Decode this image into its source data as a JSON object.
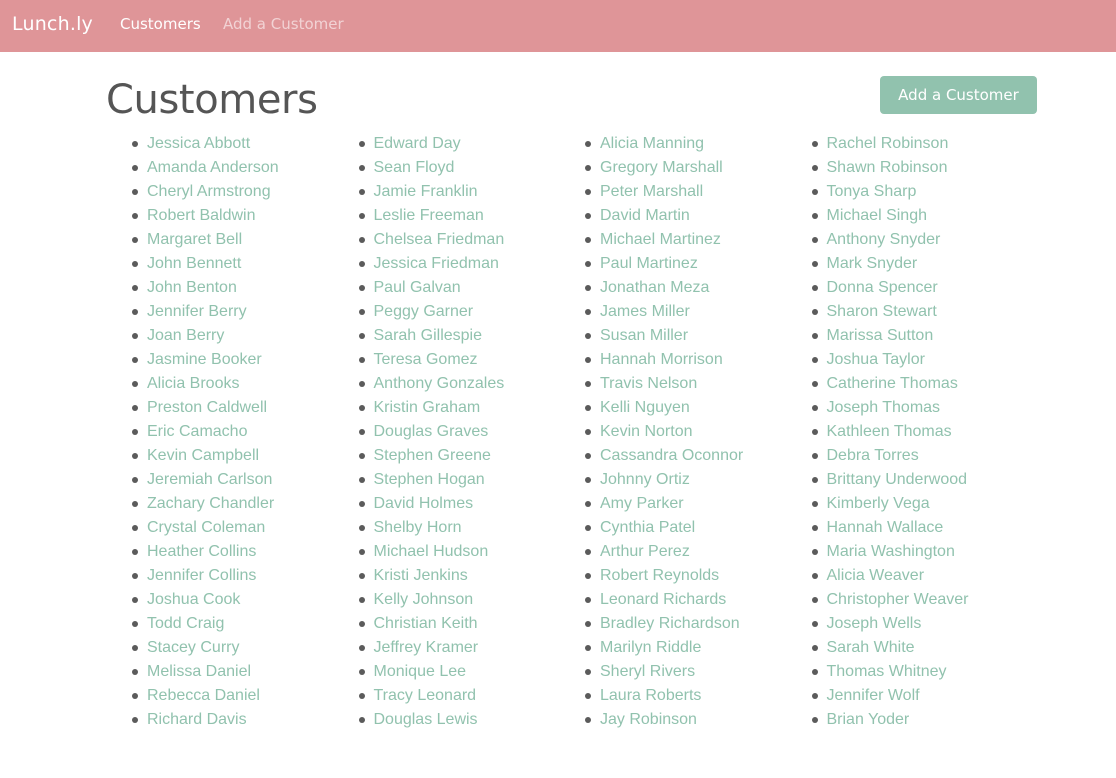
{
  "navbar": {
    "brand": "Lunch.ly",
    "links": [
      "Customers",
      "Add a Customer"
    ]
  },
  "main": {
    "title": "Customers",
    "add_button_label": "Add a Customer",
    "customers": [
      "Jessica Abbott",
      "Amanda Anderson",
      "Cheryl Armstrong",
      "Robert Baldwin",
      "Margaret Bell",
      "John Bennett",
      "John Benton",
      "Jennifer Berry",
      "Joan Berry",
      "Jasmine Booker",
      "Alicia Brooks",
      "Preston Caldwell",
      "Eric Camacho",
      "Kevin Campbell",
      "Jeremiah Carlson",
      "Zachary Chandler",
      "Crystal Coleman",
      "Heather Collins",
      "Jennifer Collins",
      "Joshua Cook",
      "Todd Craig",
      "Stacey Curry",
      "Melissa Daniel",
      "Rebecca Daniel",
      "Richard Davis",
      "Edward Day",
      "Sean Floyd",
      "Jamie Franklin",
      "Leslie Freeman",
      "Chelsea Friedman",
      "Jessica Friedman",
      "Paul Galvan",
      "Peggy Garner",
      "Sarah Gillespie",
      "Teresa Gomez",
      "Anthony Gonzales",
      "Kristin Graham",
      "Douglas Graves",
      "Stephen Greene",
      "Stephen Hogan",
      "David Holmes",
      "Shelby Horn",
      "Michael Hudson",
      "Kristi Jenkins",
      "Kelly Johnson",
      "Christian Keith",
      "Jeffrey Kramer",
      "Monique Lee",
      "Tracy Leonard",
      "Douglas Lewis",
      "Alicia Manning",
      "Gregory Marshall",
      "Peter Marshall",
      "David Martin",
      "Michael Martinez",
      "Paul Martinez",
      "Jonathan Meza",
      "James Miller",
      "Susan Miller",
      "Hannah Morrison",
      "Travis Nelson",
      "Kelli Nguyen",
      "Kevin Norton",
      "Cassandra Oconnor",
      "Johnny Ortiz",
      "Amy Parker",
      "Cynthia Patel",
      "Arthur Perez",
      "Robert Reynolds",
      "Leonard Richards",
      "Bradley Richardson",
      "Marilyn Riddle",
      "Sheryl Rivers",
      "Laura Roberts",
      "Jay Robinson",
      "Rachel Robinson",
      "Shawn Robinson",
      "Tonya Sharp",
      "Michael Singh",
      "Anthony Snyder",
      "Mark Snyder",
      "Donna Spencer",
      "Sharon Stewart",
      "Marissa Sutton",
      "Joshua Taylor",
      "Catherine Thomas",
      "Joseph Thomas",
      "Kathleen Thomas",
      "Debra Torres",
      "Brittany Underwood",
      "Kimberly Vega",
      "Hannah Wallace",
      "Maria Washington",
      "Alicia Weaver",
      "Christopher Weaver",
      "Joseph Wells",
      "Sarah White",
      "Thomas Whitney",
      "Jennifer Wolf",
      "Brian Yoder"
    ]
  },
  "colors": {
    "navbar_background": "#df9598",
    "accent": "#91c2ae",
    "title_text": "#555555",
    "bullet": "#5b5b5b"
  }
}
